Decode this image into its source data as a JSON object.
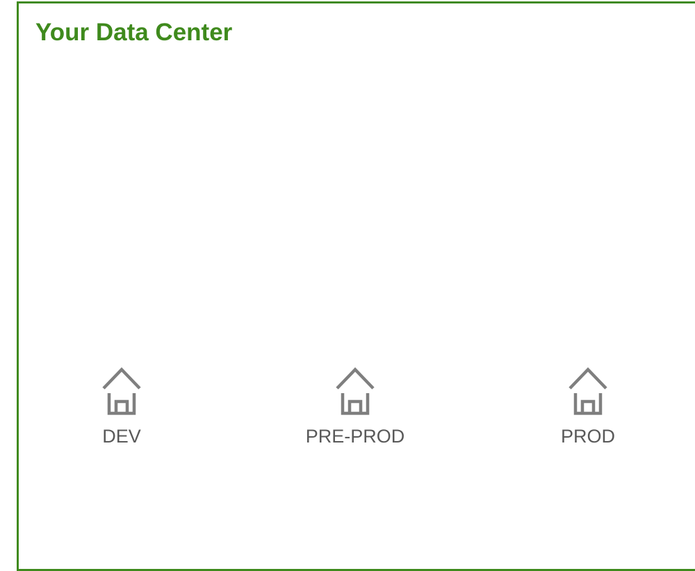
{
  "title": "Your Data Center",
  "colors": {
    "accent": "#3f8a1d",
    "icon": "#7f7f7f",
    "label": "#595959"
  },
  "environments": [
    {
      "label": "DEV",
      "icon": "home-icon"
    },
    {
      "label": "PRE-PROD",
      "icon": "home-icon"
    },
    {
      "label": "PROD",
      "icon": "home-icon"
    }
  ]
}
